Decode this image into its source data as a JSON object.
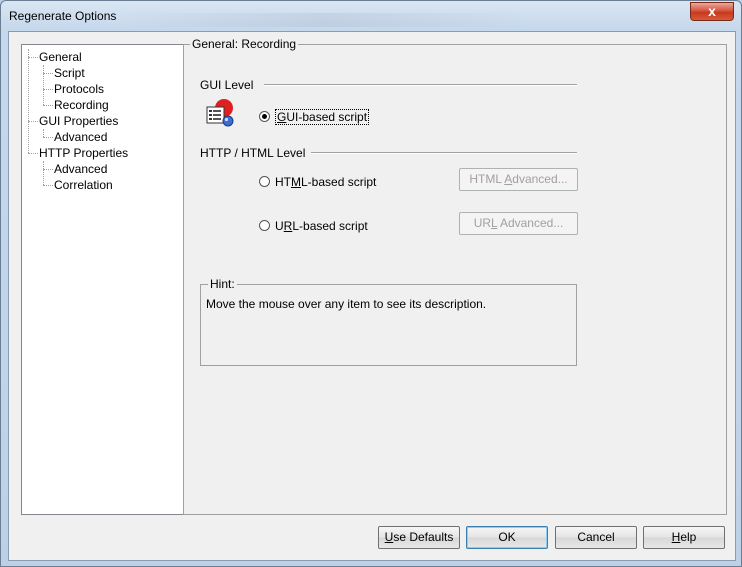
{
  "window": {
    "title": "Regenerate Options",
    "close_label": "x"
  },
  "tree": {
    "items": [
      {
        "label": "General"
      },
      {
        "label": "Script"
      },
      {
        "label": "Protocols"
      },
      {
        "label": "Recording"
      },
      {
        "label": "GUI Properties"
      },
      {
        "label": "Advanced"
      },
      {
        "label": "HTTP Properties"
      },
      {
        "label": "Advanced"
      },
      {
        "label": "Correlation"
      }
    ]
  },
  "panel": {
    "title": "General: Recording",
    "gui_level": {
      "label": "GUI Level",
      "option": {
        "label_pre": "",
        "label_u": "G",
        "label_post": "UI-based script",
        "checked": true
      }
    },
    "http_level": {
      "label": "HTTP / HTML Level",
      "html_option": {
        "label_pre": "HT",
        "label_u": "M",
        "label_post": "L-based script",
        "checked": false
      },
      "url_option": {
        "label_pre": "U",
        "label_u": "R",
        "label_post": "L-based script",
        "checked": false
      },
      "html_advanced": {
        "label_pre": "HTML ",
        "label_u": "A",
        "label_post": "dvanced..."
      },
      "url_advanced": {
        "label_pre": "UR",
        "label_u": "L",
        "label_post": " Advanced..."
      }
    },
    "hint": {
      "title": "Hint:",
      "text": "Move the mouse over any item to see its description."
    }
  },
  "buttons": {
    "use_defaults": {
      "label_u": "U",
      "label_post": "se Defaults"
    },
    "ok": {
      "label": "OK"
    },
    "cancel": {
      "label": "Cancel"
    },
    "help": {
      "label_u": "H",
      "label_post": "elp"
    }
  }
}
